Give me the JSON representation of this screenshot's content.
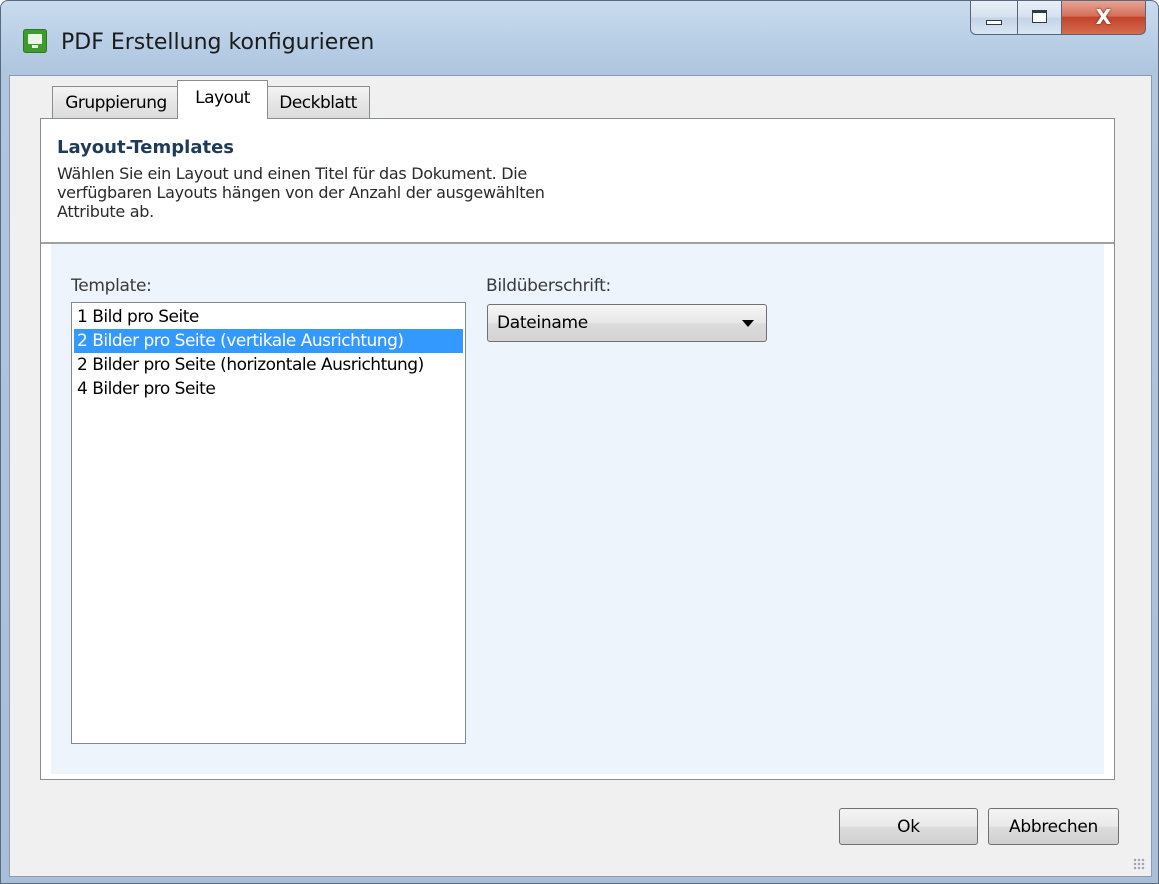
{
  "window": {
    "title": "PDF Erstellung konfigurieren",
    "icon": "pdf-app-icon"
  },
  "caption_buttons": {
    "minimize": "minimize-icon",
    "maximize": "maximize-icon",
    "close_glyph": "X"
  },
  "tabs": [
    {
      "label": "Gruppierung",
      "selected": false
    },
    {
      "label": "Layout",
      "selected": true
    },
    {
      "label": "Deckblatt",
      "selected": false
    }
  ],
  "header": {
    "title": "Layout-Templates",
    "description": "Wählen Sie ein Layout und einen Titel für das Dokument. Die verfügbaren Layouts hängen von der Anzahl der ausgewählten Attribute ab."
  },
  "template": {
    "label": "Template:",
    "items": [
      "1 Bild pro Seite",
      "2 Bilder pro Seite (vertikale Ausrichtung)",
      "2 Bilder pro Seite (horizontale Ausrichtung)",
      "4 Bilder pro Seite"
    ],
    "selected_index": 1
  },
  "caption": {
    "label": "Bildüberschrift:",
    "selected_value": "Dateiname"
  },
  "buttons": {
    "ok": "Ok",
    "cancel": "Abbrechen"
  },
  "colors": {
    "selection": "#3399ff",
    "header_title": "#1e3b5a"
  }
}
